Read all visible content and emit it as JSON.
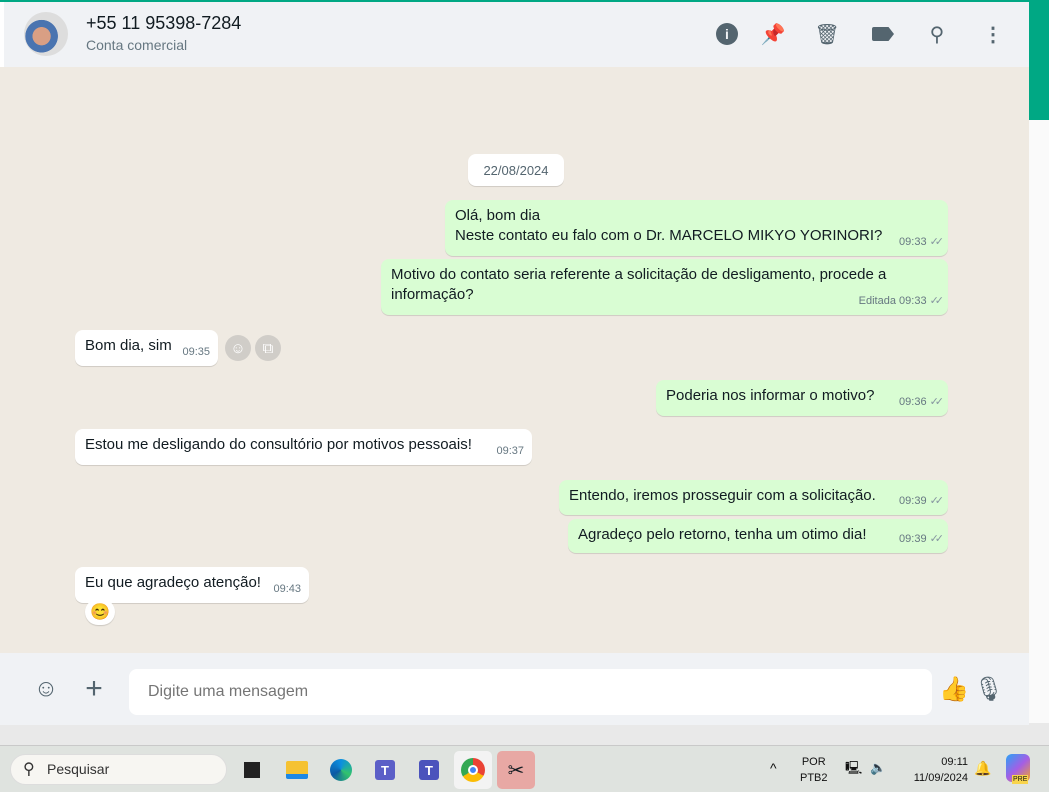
{
  "header": {
    "title": "+55 11 95398-7284",
    "subtitle": "Conta comercial"
  },
  "date_label": "22/08/2024",
  "messages": [
    {
      "dir": "out",
      "lines": [
        "Olá, bom dia",
        "Neste contato eu falo com o Dr. MARCELO MIKYO YORINORI?"
      ],
      "time": "09:33"
    },
    {
      "dir": "out",
      "lines": [
        "Motivo do contato seria referente a solicitação de desligamento, procede a",
        "informação?"
      ],
      "edited": "Editada",
      "time": "09:33"
    },
    {
      "dir": "in",
      "text": "Bom dia, sim",
      "time": "09:35"
    },
    {
      "dir": "out",
      "text": "Poderia nos informar o motivo?",
      "time": "09:36"
    },
    {
      "dir": "in",
      "text": "Estou me desligando do consultório por motivos pessoais!",
      "time": "09:37"
    },
    {
      "dir": "out",
      "text": "Entendo, iremos prosseguir com a solicitação.",
      "time": "09:39"
    },
    {
      "dir": "out",
      "text": "Agradeço pelo retorno, tenha um otimo dia!",
      "time": "09:39"
    },
    {
      "dir": "in",
      "text": "Eu que agradeço atenção!",
      "time": "09:43",
      "reaction": "😊"
    }
  ],
  "composer": {
    "placeholder": "Digite uma mensagem"
  },
  "taskbar": {
    "search_placeholder": "Pesquisar",
    "lang1": "POR",
    "lang2": "PTB2",
    "time": "09:11",
    "date": "11/09/2024",
    "copilot_badge": "PRE"
  }
}
